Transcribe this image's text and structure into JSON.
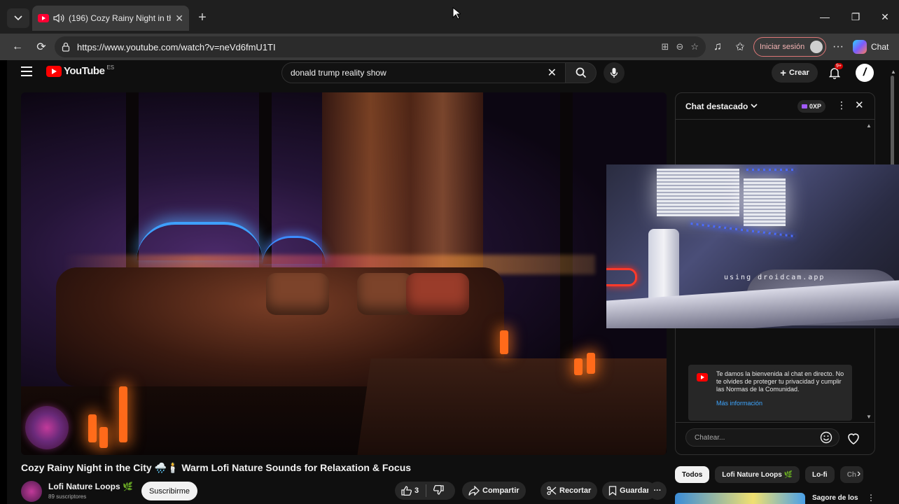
{
  "browser": {
    "tab": {
      "title": "(196) Cozy Rainy Night in the"
    },
    "url": "https://www.youtube.com/watch?v=neVd6fmU1TI",
    "signin_label": "Iniciar sesión",
    "copilot_label": "Chat"
  },
  "youtube": {
    "logo_text": "YouTube",
    "region": "ES",
    "search_query": "donald trump reality show",
    "create_label": "Crear",
    "notification_count": "9+"
  },
  "video": {
    "title": "Cozy Rainy Night in the City 🌧️🕯️ Warm Lofi Nature Sounds for Relaxation & Focus",
    "channel_name": "Lofi Nature Loops 🌿",
    "subscribers": "89 suscriptores",
    "subscribe_label": "Suscribirme",
    "like_count": "3",
    "share_label": "Compartir",
    "clip_label": "Recortar",
    "save_label": "Guardar"
  },
  "chat": {
    "title": "Chat destacado",
    "badge": "0XP",
    "welcome_message": "Te damos la bienvenida al chat en directo. No te olvides de proteger tu privacidad y cumplir las Normas de la Comunidad.",
    "welcome_link": "Más información",
    "input_placeholder": "Chatear..."
  },
  "chips": [
    "Todos",
    "Lofi Nature Loops 🌿",
    "Lo-fi",
    "Ch"
  ],
  "recommendation": {
    "title": "Sagore de los"
  },
  "camera_overlay": {
    "watermark": "using droidcam.app"
  },
  "colors": {
    "accent": "#ff0000",
    "link": "#3ea6ff",
    "background": "#0f0f0f"
  }
}
